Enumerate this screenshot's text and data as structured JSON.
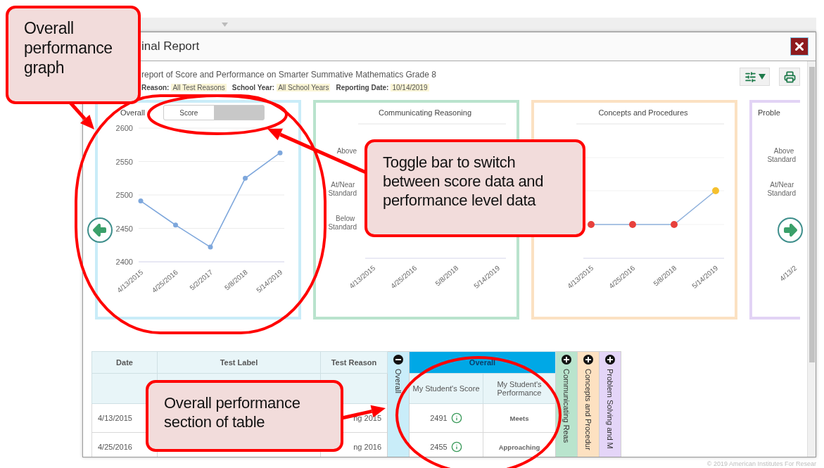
{
  "window": {
    "title": "inal Report"
  },
  "report": {
    "subtitle": "report of Score and Performance on Smarter Summative Mathematics Grade 8",
    "filters": [
      {
        "label": "Reason:",
        "value": "All Test Reasons"
      },
      {
        "label": "School Year:",
        "value": "All School Years"
      },
      {
        "label": "Reporting Date:",
        "value": "10/14/2019"
      }
    ]
  },
  "charts": [
    {
      "kind": "score",
      "title": "Overall",
      "toggle": {
        "label": "Score",
        "selected": true
      },
      "chart_data": {
        "type": "line",
        "categories": [
          "4/13/2015",
          "4/25/2016",
          "5/2/2017",
          "5/8/2018",
          "5/14/2019"
        ],
        "series": [
          {
            "color": "#7ea7dc",
            "marker": true,
            "values": [
              2491,
              2455,
              2422,
              2525,
              2563
            ]
          }
        ],
        "grid": true,
        "ylim": [
          2400,
          2600
        ],
        "yticks": [
          2400,
          2450,
          2500,
          2550,
          2600
        ]
      }
    },
    {
      "kind": "level",
      "title": "Communicating Reasoning",
      "y_labels": [
        "Above",
        "At/Near Standard",
        "Below Standard"
      ],
      "x_labels": [
        "4/13/2015",
        "4/25/2016",
        "5/8/2018",
        "5/14/2019"
      ]
    },
    {
      "kind": "level",
      "title": "Concepts and Procedures",
      "x_labels": [
        "4/13/2015",
        "4/25/2016",
        "5/8/2018",
        "5/14/2019"
      ],
      "points": [
        {
          "kind": "below",
          "color": "#e8403c"
        },
        {
          "kind": "below",
          "color": "#e8403c"
        },
        {
          "kind": "below",
          "color": "#e8403c"
        },
        {
          "kind": "at_near",
          "color": "#f5c02e"
        }
      ]
    },
    {
      "kind": "partial",
      "title": "Proble",
      "y_labels": [
        "Above Standard",
        "At/Near Standard"
      ],
      "x_labels": [
        "4/13/2"
      ]
    }
  ],
  "table": {
    "columns": [
      "Date",
      "Test Label",
      "Test Reason"
    ],
    "groups": [
      {
        "label": "Overall",
        "expanded": true,
        "color": "#c9edf9",
        "header": "Overall",
        "subcolumns": [
          "My Student's Score",
          "My Student's Performance"
        ]
      },
      {
        "label": "Communicating Reas",
        "expanded": false,
        "color": "#b9e4cd"
      },
      {
        "label": "Concepts and Procedur",
        "expanded": false,
        "color": "#fde1c1"
      },
      {
        "label": "Problem Solving and M",
        "expanded": false,
        "color": "#e4d5f8"
      }
    ],
    "rows": [
      {
        "date": "4/13/2015",
        "test_reason": "ng 2015",
        "score": "2491",
        "performance": "Meets"
      },
      {
        "date": "4/25/2016",
        "test_reason": "ng 2016",
        "score": "2455",
        "performance": "Approaching"
      }
    ]
  },
  "annotations": [
    {
      "text": "Overall performance graph"
    },
    {
      "text": "Toggle bar to switch between score data and performance level data"
    },
    {
      "text": "Overall performance section of table"
    }
  ],
  "footer": {
    "copyright": "© 2019 American Institutes For Resear"
  }
}
